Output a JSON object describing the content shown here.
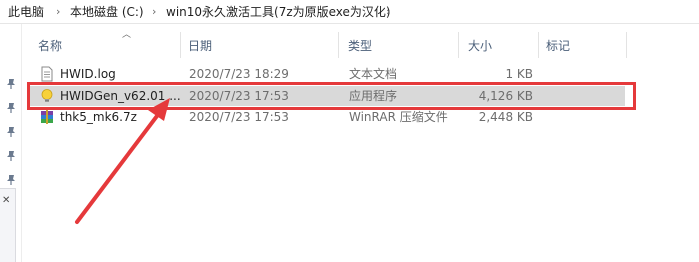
{
  "breadcrumb": {
    "items": [
      "此电脑",
      "本地磁盘 (C:)",
      "win10永久激活工具(7z为原版exe为汉化)"
    ],
    "separator": "›"
  },
  "columns": {
    "name": "名称",
    "date": "日期",
    "type": "类型",
    "size": "大小",
    "tags": "标记"
  },
  "files": [
    {
      "name": "HWID.log",
      "date": "2020/7/23 18:29",
      "type": "文本文档",
      "size": "1 KB",
      "icon": "text-file-icon"
    },
    {
      "name": "HWIDGen_v62.01 ...",
      "date": "2020/7/23 17:53",
      "type": "应用程序",
      "size": "4,126 KB",
      "icon": "lightbulb-app-icon"
    },
    {
      "name": "thk5_mk6.7z",
      "date": "2020/7/23 17:53",
      "type": "WinRAR 压缩文件",
      "size": "2,448 KB",
      "icon": "winrar-archive-icon"
    }
  ],
  "annotation": {
    "color": "#e5393b",
    "shape": "rectangle-with-arrow",
    "target": "HWIDGen_v62.01 ..."
  },
  "colors": {
    "selected_row": "#d9d9d9",
    "header_text": "#4c607a"
  }
}
